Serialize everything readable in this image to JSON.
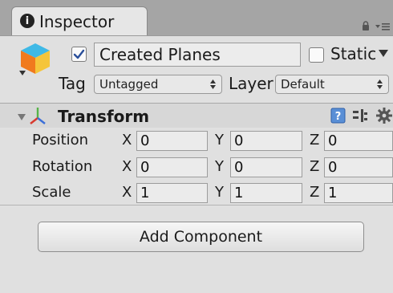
{
  "window": {
    "tab_label": "Inspector",
    "tab_icon_glyph": "i",
    "icons": [
      "info-icon",
      "lock-icon",
      "menu-icon"
    ]
  },
  "gameobject": {
    "active": true,
    "name": "Created Planes",
    "static_label": "Static",
    "static_checked": false,
    "tag_label": "Tag",
    "tag_value": "Untagged",
    "layer_label": "Layer",
    "layer_value": "Default"
  },
  "transform": {
    "title": "Transform",
    "expanded": true,
    "rows": [
      {
        "label": "Position",
        "x": "0",
        "y": "0",
        "z": "0"
      },
      {
        "label": "Rotation",
        "x": "0",
        "y": "0",
        "z": "0"
      },
      {
        "label": "Scale",
        "x": "1",
        "y": "1",
        "z": "1"
      }
    ],
    "axis_x": "X",
    "axis_y": "Y",
    "axis_z": "Z"
  },
  "add_component_label": "Add Component",
  "colors": {
    "panel_bg": "#e0e0e0",
    "tab_strip": "#a5a5a5",
    "help_icon_blue": "#5a8fd6"
  }
}
